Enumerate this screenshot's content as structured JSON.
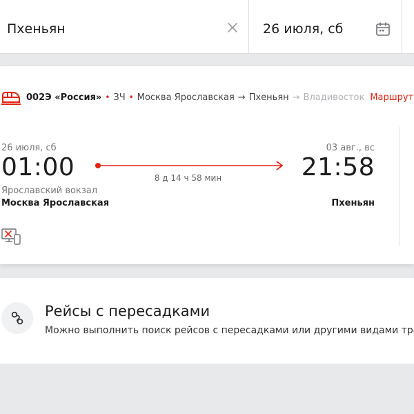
{
  "search": {
    "destination": "Пхеньян",
    "date": "26 июля, сб"
  },
  "train": {
    "number_name": "002Э «Россия»",
    "type": "ЗЧ",
    "from": "Москва Ярославская",
    "to": "Пхеньян",
    "final": "Владивосток",
    "route_link": "Маршрут",
    "departure": {
      "date": "26 июля, сб",
      "time": "01:00",
      "station_sub": "Ярославский вокзал",
      "station": "Москва Ярославская"
    },
    "arrival": {
      "date": "03 авг., вс",
      "time": "21:58",
      "station": "Пхеньян"
    },
    "duration": "8 д 14 ч 58 мин"
  },
  "transfer": {
    "title": "Рейсы с пересадками",
    "description": "Можно выполнить поиск рейсов с пересадками или другими видами транспорта"
  },
  "colors": {
    "accent": "#e32213",
    "text": "#1d1d1d",
    "muted": "#777777",
    "background": "#e8e9eb"
  },
  "icons": {
    "clear": "close-icon",
    "calendar": "calendar-icon",
    "train": "train-icon",
    "device": "no-eregistration-icon",
    "transfer": "link-icon"
  }
}
